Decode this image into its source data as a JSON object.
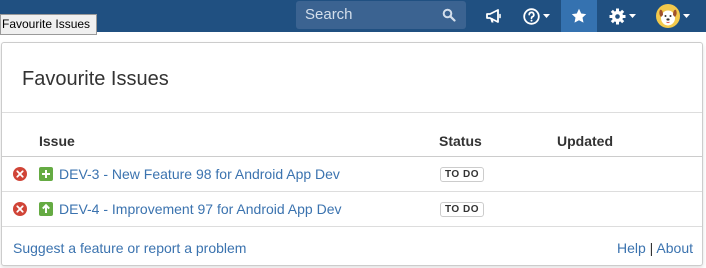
{
  "browser_tooltip": "Favourite Issues",
  "header": {
    "search_placeholder": "Search",
    "icons": [
      "search-icon",
      "megaphone-icon",
      "help-icon",
      "star-icon",
      "gear-icon",
      "avatar"
    ]
  },
  "panel": {
    "title": "Favourite Issues",
    "columns": {
      "issue": "Issue",
      "status": "Status",
      "updated": "Updated"
    },
    "rows": [
      {
        "key_summary": "DEV-3 - New Feature 98 for Android App Dev",
        "type": "new-feature",
        "status": "TO DO",
        "updated": ""
      },
      {
        "key_summary": "DEV-4 - Improvement 97 for Android App Dev",
        "type": "improvement",
        "status": "TO DO",
        "updated": ""
      }
    ],
    "footer": {
      "feedback": "Suggest a feature or report a problem",
      "help": "Help",
      "separator": "|",
      "about": "About"
    }
  },
  "colors": {
    "nav_background": "#205081",
    "active_nav": "#3572b0",
    "link": "#3b73af",
    "remove_icon": "#d04437",
    "issue_type_icon": "#65ab43"
  }
}
